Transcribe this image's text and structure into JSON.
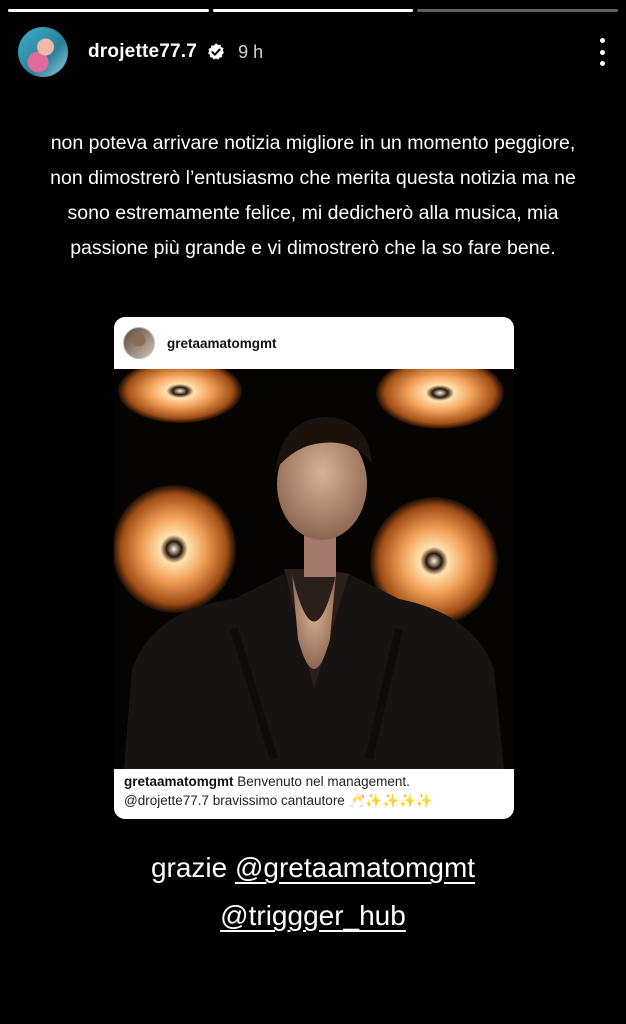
{
  "story": {
    "segments": [
      1.0,
      1.0,
      0.0
    ],
    "user": {
      "username": "drojette77.7",
      "verified": true,
      "time": "9 h"
    },
    "caption": "non poteva arrivare notizia migliore in un momento peggiore, non dimostrerò l’entusiasmo che merita questa notizia ma ne sono estremamente felice, mi dedicherò alla musica, mia passione più grande e vi dimostrerò che la so fare bene.",
    "shared_post": {
      "username": "gretaamatomgmt",
      "caption_user": "gretaamatomgmt",
      "caption_text": "Benvenuto nel management.",
      "caption_line2": "@drojette77.7 bravissimo cantautore 🥂✨✨✨✨"
    },
    "thanks": {
      "prefix": "grazie ",
      "mention1": "@gretaamatomgmt",
      "mention2": "@triggger_hub"
    }
  },
  "colors": {
    "background": "#000000",
    "text": "#ffffff",
    "card": "#ffffff"
  },
  "icons": {
    "verified": "verified-badge-icon",
    "more": "more-vertical-icon"
  }
}
